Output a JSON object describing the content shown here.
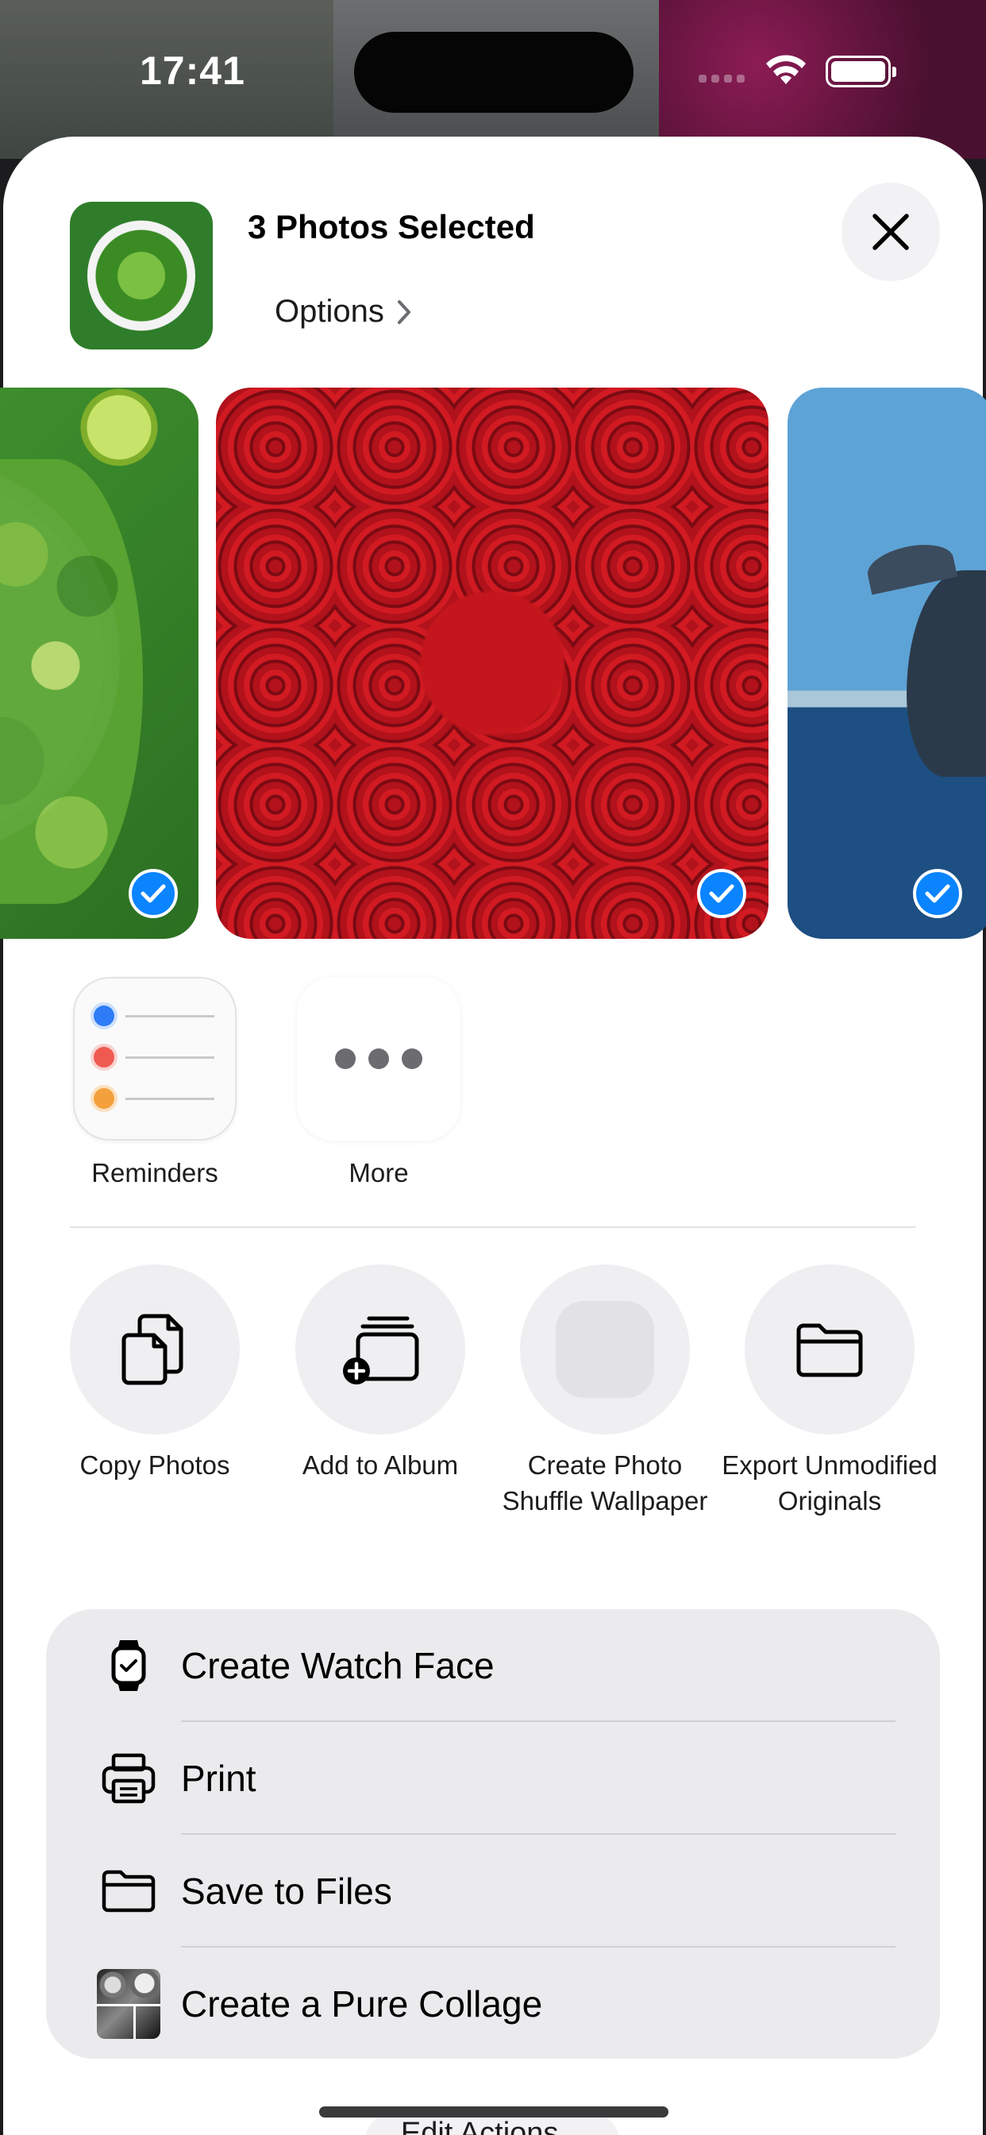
{
  "status_bar": {
    "time": "17:41"
  },
  "header": {
    "title": "3 Photos Selected",
    "options_label": "Options"
  },
  "photos": [
    {
      "subject": "salad",
      "selected": true
    },
    {
      "subject": "red roses",
      "selected": true
    },
    {
      "subject": "whale",
      "selected": true
    }
  ],
  "apps": [
    {
      "label": "Reminders",
      "icon": "reminders-icon"
    },
    {
      "label": "More",
      "icon": "more-icon"
    }
  ],
  "actions": [
    {
      "label": "Copy Photos",
      "icon": "copy-icon"
    },
    {
      "label": "Add to Album",
      "icon": "add-album-icon"
    },
    {
      "label": "Create Photo Shuffle Wallpaper",
      "icon": "wallpaper-placeholder-icon"
    },
    {
      "label": "Export Unmodified Originals",
      "icon": "folder-icon"
    }
  ],
  "list": [
    {
      "label": "Create Watch Face",
      "icon": "watch-icon"
    },
    {
      "label": "Print",
      "icon": "printer-icon"
    },
    {
      "label": "Save to Files",
      "icon": "folder-icon"
    },
    {
      "label": "Create a Pure Collage",
      "icon": "collage-app-icon"
    }
  ],
  "footer": {
    "edit_actions_label": "Edit Actions..."
  },
  "colors": {
    "accent": "#0A84FF",
    "sheet": "#FFFFFF",
    "list_bg": "#EBEBED"
  }
}
